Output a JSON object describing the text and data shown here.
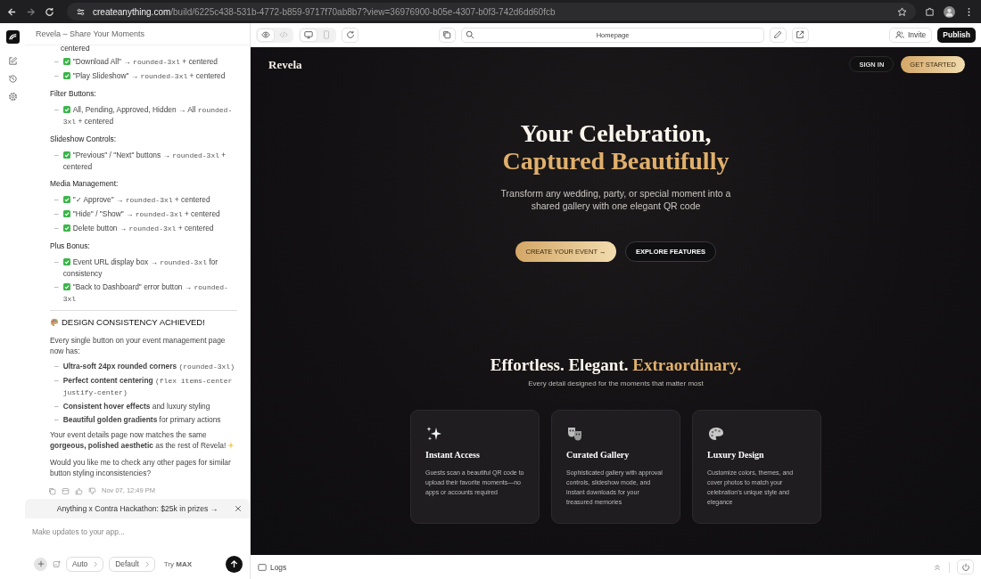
{
  "browser": {
    "url_domain": "createanything.com",
    "url_path": "/build/6225c438-531b-4772-b859-9717f70ab8b7?view=36976900-b05e-4307-b0f3-742d6dd60fcb"
  },
  "chat": {
    "title": "Revela – Share Your Moments",
    "blocks": [
      {
        "kind": "fragment",
        "text": "centered"
      },
      {
        "kind": "bullet",
        "marker": "–",
        "check": true,
        "parts": [
          {
            "text": "\"Download All\" → "
          },
          {
            "text": "rounded-3xl",
            "code": true
          },
          {
            "text": " + centered"
          }
        ]
      },
      {
        "kind": "bullet",
        "marker": "–",
        "check": true,
        "parts": [
          {
            "text": "\"Play Slideshow\" → "
          },
          {
            "text": "rounded-3xl",
            "code": true
          },
          {
            "text": " + centered"
          }
        ]
      },
      {
        "kind": "heading",
        "text": "Filter Buttons:"
      },
      {
        "kind": "bullet",
        "marker": "–",
        "check": true,
        "parts": [
          {
            "text": "All, Pending, Approved, Hidden → All "
          },
          {
            "text": "rounded-3xl",
            "code": true
          },
          {
            "text": " + centered"
          }
        ]
      },
      {
        "kind": "heading",
        "text": "Slideshow Controls:"
      },
      {
        "kind": "bullet",
        "marker": "–",
        "check": true,
        "parts": [
          {
            "text": "\"Previous\" / \"Next\" buttons → "
          },
          {
            "text": "rounded-3xl",
            "code": true
          },
          {
            "text": " + centered"
          }
        ]
      },
      {
        "kind": "heading",
        "text": "Media Management:"
      },
      {
        "kind": "bullet",
        "marker": "–",
        "check": true,
        "parts": [
          {
            "text": "\"✓ Approve\" → "
          },
          {
            "text": "rounded-3xl",
            "code": true
          },
          {
            "text": " + centered"
          }
        ]
      },
      {
        "kind": "bullet",
        "marker": "–",
        "check": true,
        "parts": [
          {
            "text": "\"Hide\" / \"Show\" → "
          },
          {
            "text": "rounded-3xl",
            "code": true
          },
          {
            "text": " + centered"
          }
        ]
      },
      {
        "kind": "bullet",
        "marker": "–",
        "check": true,
        "parts": [
          {
            "text": "Delete button → "
          },
          {
            "text": "rounded-3xl",
            "code": true
          },
          {
            "text": " + centered"
          }
        ]
      },
      {
        "kind": "heading",
        "text": "Plus Bonus:"
      },
      {
        "kind": "bullet",
        "marker": "–",
        "check": true,
        "parts": [
          {
            "text": "Event URL display box → "
          },
          {
            "text": "rounded-3xl",
            "code": true
          },
          {
            "text": " for consistency"
          }
        ]
      },
      {
        "kind": "bullet",
        "marker": "–",
        "check": true,
        "parts": [
          {
            "text": "\"Back to Dashboard\" error button → "
          },
          {
            "text": "rounded-3xl",
            "code": true
          }
        ]
      },
      {
        "kind": "rule"
      },
      {
        "kind": "title",
        "text": "DESIGN CONSISTENCY ACHIEVED!"
      },
      {
        "kind": "para",
        "text": "Every single button on your event management page now has:"
      },
      {
        "kind": "bullet",
        "marker": "–",
        "check": false,
        "parts": [
          {
            "text": "**Ultra-soft 24px rounded corners** "
          },
          {
            "text": "(rounded-3xl)",
            "code": true
          }
        ]
      },
      {
        "kind": "bullet",
        "marker": "–",
        "check": false,
        "parts": [
          {
            "text": "**Perfect content centering** "
          },
          {
            "text": "(flex items-center justify-center)",
            "code": true
          }
        ]
      },
      {
        "kind": "bullet",
        "marker": "–",
        "check": false,
        "parts": [
          {
            "text": "**Consistent hover effects** and luxury styling"
          }
        ]
      },
      {
        "kind": "bullet",
        "marker": "–",
        "check": false,
        "parts": [
          {
            "text": "**Beautiful golden gradients** for primary actions"
          }
        ]
      },
      {
        "kind": "para",
        "text": "Your event details page now matches the same **gorgeous, polished aesthetic** as the rest of Revela!",
        "sparkle": true
      },
      {
        "kind": "para",
        "text": "Would you like me to check any other pages for similar button styling inconsistencies?"
      }
    ],
    "timestamp": "Nov 07, 12:49 PM",
    "banner": "Anything x Contra Hackathon: $25k in prizes →",
    "input": {
      "placeholder": "Make updates to your app..."
    },
    "chips": [
      "Auto",
      "Default"
    ],
    "try": "Try **MAX**"
  },
  "toolbar": {
    "page_field": "Homepage",
    "invite": "Invite",
    "publish": "Publish"
  },
  "site": {
    "brand": "Revela",
    "sign_in": "SIGN IN",
    "get_started": "GET STARTED",
    "hero": {
      "title_line1": "Your Celebration,",
      "title_line2": "Captured Beautifully",
      "subtitle": "Transform any wedding, party, or special moment into a shared gallery with one elegant QR code",
      "primary": "CREATE YOUR EVENT →",
      "secondary": "EXPLORE FEATURES"
    },
    "features": {
      "title_a": "Effortless. Elegant.",
      "title_b": "Extraordinary.",
      "subtitle": "Every detail designed for the moments that matter most",
      "cards": [
        {
          "kind": "sparkles",
          "title": "Instant Access",
          "text": "Guests scan a beautiful QR code to upload their favorite moments—no apps or accounts required"
        },
        {
          "kind": "masks",
          "title": "Curated Gallery",
          "text": "Sophisticated gallery with approval controls, slideshow mode, and instant downloads for your treasured memories"
        },
        {
          "kind": "palette",
          "title": "Luxury Design",
          "text": "Customize colors, themes, and cover photos to match your celebration's unique style and elegance"
        }
      ]
    }
  },
  "logs": "Logs"
}
